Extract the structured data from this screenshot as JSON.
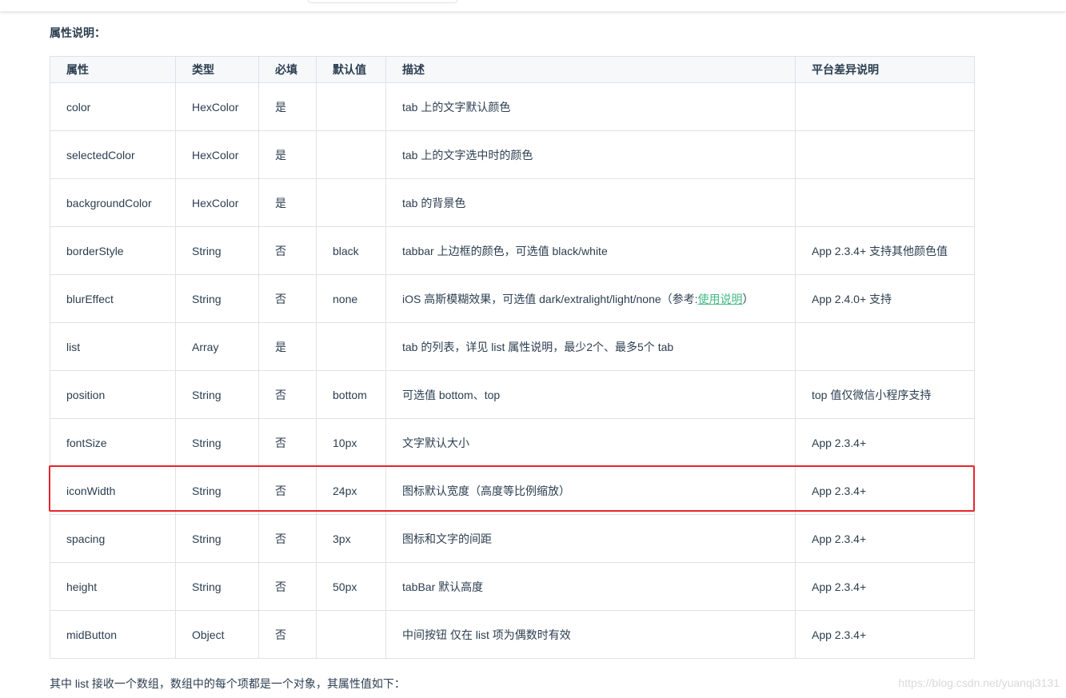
{
  "section_heading": "属性说明：",
  "table": {
    "headers": [
      "属性",
      "类型",
      "必填",
      "默认值",
      "描述",
      "平台差异说明"
    ],
    "rows": [
      {
        "attr": "color",
        "type": "HexColor",
        "required": "是",
        "default": "",
        "desc": "tab 上的文字默认颜色",
        "note": ""
      },
      {
        "attr": "selectedColor",
        "type": "HexColor",
        "required": "是",
        "default": "",
        "desc": "tab 上的文字选中时的颜色",
        "note": ""
      },
      {
        "attr": "backgroundColor",
        "type": "HexColor",
        "required": "是",
        "default": "",
        "desc": "tab 的背景色",
        "note": ""
      },
      {
        "attr": "borderStyle",
        "type": "String",
        "required": "否",
        "default": "black",
        "desc": "tabbar 上边框的颜色，可选值 black/white",
        "note": "App 2.3.4+ 支持其他颜色值"
      },
      {
        "attr": "blurEffect",
        "type": "String",
        "required": "否",
        "default": "none",
        "desc_prefix": "iOS 高斯模糊效果，可选值 dark/extralight/light/none（参考:",
        "desc_link": "使用说明",
        "desc_suffix": "）",
        "note": "App 2.4.0+ 支持"
      },
      {
        "attr": "list",
        "type": "Array",
        "required": "是",
        "default": "",
        "desc": "tab 的列表，详见 list 属性说明，最少2个、最多5个 tab",
        "note": ""
      },
      {
        "attr": "position",
        "type": "String",
        "required": "否",
        "default": "bottom",
        "desc": "可选值 bottom、top",
        "note": "top 值仅微信小程序支持"
      },
      {
        "attr": "fontSize",
        "type": "String",
        "required": "否",
        "default": "10px",
        "desc": "文字默认大小",
        "note": "App 2.3.4+"
      },
      {
        "attr": "iconWidth",
        "type": "String",
        "required": "否",
        "default": "24px",
        "desc": "图标默认宽度（高度等比例缩放）",
        "note": "App 2.3.4+"
      },
      {
        "attr": "spacing",
        "type": "String",
        "required": "否",
        "default": "3px",
        "desc": "图标和文字的间距",
        "note": "App 2.3.4+"
      },
      {
        "attr": "height",
        "type": "String",
        "required": "否",
        "default": "50px",
        "desc": "tabBar 默认高度",
        "note": "App 2.3.4+"
      },
      {
        "attr": "midButton",
        "type": "Object",
        "required": "否",
        "default": "",
        "desc": "中间按钮 仅在 list 项为偶数时有效",
        "note": "App 2.3.4+"
      }
    ]
  },
  "footer_text": "其中 list 接收一个数组，数组中的每个项都是一个对象，其属性值如下：",
  "watermark": "https://blog.csdn.net/yuanqi3131",
  "colors": {
    "highlight": "#e5252a",
    "link": "#42b983",
    "header_bg": "#f6f8fa",
    "border": "#dfe2e5"
  }
}
